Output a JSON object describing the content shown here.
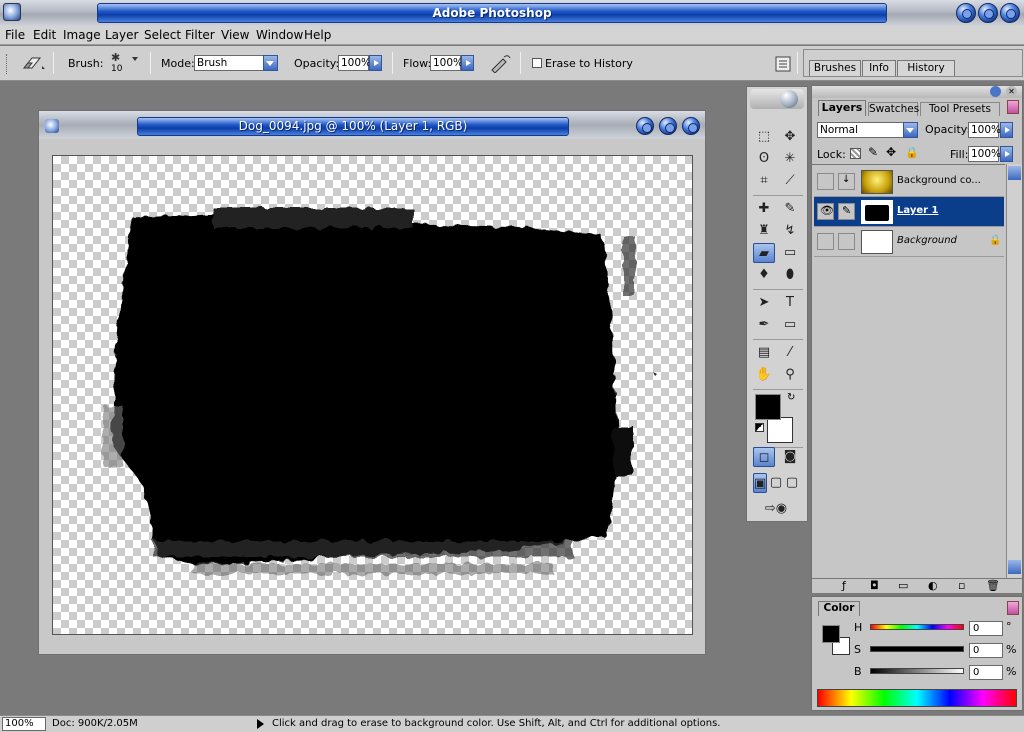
{
  "app": {
    "title": "Adobe Photoshop"
  },
  "menu": [
    "File",
    "Edit",
    "Image",
    "Layer",
    "Select",
    "Filter",
    "View",
    "Window",
    "Help"
  ],
  "options": {
    "brush_label": "Brush:",
    "brush_size": "10",
    "mode_label": "Mode:",
    "mode_value": "Brush",
    "opacity_label": "Opacity:",
    "opacity_value": "100%",
    "flow_label": "Flow:",
    "flow_value": "100%",
    "erase_history_label": "Erase to History"
  },
  "palette_well": {
    "tabs": [
      "Brushes",
      "Info",
      "History"
    ]
  },
  "document": {
    "title": "Dog_0094.jpg @ 100% (Layer 1, RGB)"
  },
  "layers_panel": {
    "tabs": [
      "Layers",
      "Swatches",
      "Tool Presets"
    ],
    "blend_mode": "Normal",
    "opacity_label": "Opacity:",
    "opacity_value": "100%",
    "lock_label": "Lock:",
    "fill_label": "Fill:",
    "fill_value": "100%",
    "layers": [
      {
        "name": "Background co..."
      },
      {
        "name": "Layer 1",
        "selected": true
      },
      {
        "name": "Background",
        "locked": true
      }
    ]
  },
  "color_panel": {
    "title": "Color",
    "channels": [
      {
        "label": "H",
        "value": "0",
        "unit": "°"
      },
      {
        "label": "S",
        "value": "0",
        "unit": "%"
      },
      {
        "label": "B",
        "value": "0",
        "unit": "%"
      }
    ]
  },
  "status": {
    "zoom": "100%",
    "doc_size": "Doc: 900K/2.05M",
    "hint": "Click and drag to erase to background color.  Use Shift, Alt, and Ctrl for additional options."
  },
  "icons": {
    "eraser": "eraser-icon",
    "airbrush": "airbrush-icon",
    "palette": "palette-well-icon",
    "eye": "eye-icon",
    "lock": "lock-icon",
    "trash": "trash-icon",
    "new_layer": "new-layer-icon"
  }
}
